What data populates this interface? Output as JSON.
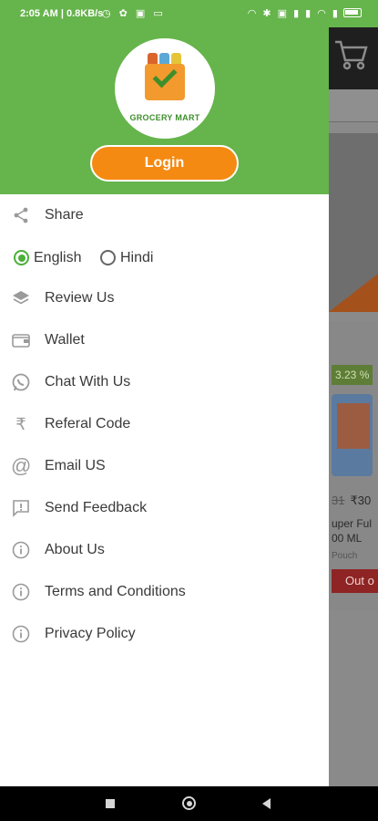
{
  "status_bar": {
    "time": "2:05 AM",
    "speed": "0.8KB/s",
    "battery_icon": "battery-icon"
  },
  "drawer": {
    "logo_text": "GROCERY MART",
    "login_label": "Login",
    "menu": {
      "share": "Share",
      "review": "Review Us",
      "wallet": "Wallet",
      "chat": "Chat With Us",
      "referal": "Referal Code",
      "email": "Email US",
      "feedback": "Send Feedback",
      "about": "About Us",
      "terms": "Terms and Conditions",
      "privacy": "Privacy Policy"
    },
    "language": {
      "options": [
        "English",
        "Hindi"
      ],
      "selected": "English"
    }
  },
  "background_app": {
    "discount": "3.23 %",
    "old_price": "31",
    "price": "₹30",
    "product_name_line1": "uper Ful",
    "product_name_line2": "00 ML",
    "product_sub": "Pouch",
    "stock_label": "Out o"
  },
  "colors": {
    "header_green": "#66b44c",
    "login_orange": "#f58a12",
    "radio_green": "#4caf3a"
  }
}
